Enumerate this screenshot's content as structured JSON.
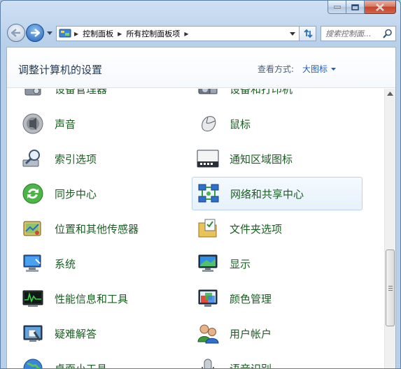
{
  "address": {
    "crumbs": [
      "控制面板",
      "所有控制面板项"
    ]
  },
  "search": {
    "placeholder": "搜索控制面..."
  },
  "header": {
    "title": "调整计算机的设置",
    "view_by_label": "查看方式:",
    "view_by_value": "大图标"
  },
  "items": [
    {
      "label": "设备管理器",
      "icon": "device-manager-icon"
    },
    {
      "label": "设备和打印机",
      "icon": "devices-printers-icon"
    },
    {
      "label": "声音",
      "icon": "speaker-icon"
    },
    {
      "label": "鼠标",
      "icon": "mouse-icon"
    },
    {
      "label": "索引选项",
      "icon": "indexing-icon"
    },
    {
      "label": "通知区域图标",
      "icon": "notification-area-icon"
    },
    {
      "label": "同步中心",
      "icon": "sync-center-icon"
    },
    {
      "label": "网络和共享中心",
      "icon": "network-sharing-icon"
    },
    {
      "label": "位置和其他传感器",
      "icon": "location-sensors-icon"
    },
    {
      "label": "文件夹选项",
      "icon": "folder-options-icon"
    },
    {
      "label": "系统",
      "icon": "system-icon"
    },
    {
      "label": "显示",
      "icon": "display-icon"
    },
    {
      "label": "性能信息和工具",
      "icon": "performance-icon"
    },
    {
      "label": "颜色管理",
      "icon": "color-management-icon"
    },
    {
      "label": "疑难解答",
      "icon": "troubleshooting-icon"
    },
    {
      "label": "用户帐户",
      "icon": "user-accounts-icon"
    },
    {
      "label": "桌面小工具",
      "icon": "globe-icon"
    },
    {
      "label": "语音识别",
      "icon": "microphone-icon"
    }
  ],
  "colors": {
    "link_green": "#1a5e22",
    "accent_blue": "#1e5ebd"
  }
}
